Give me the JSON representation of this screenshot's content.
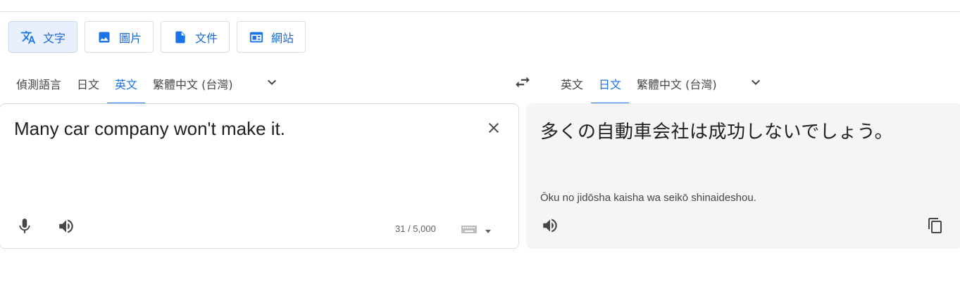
{
  "modes": [
    {
      "label": "文字",
      "icon": "translate-icon",
      "active": true
    },
    {
      "label": "圖片",
      "icon": "image-icon",
      "active": false
    },
    {
      "label": "文件",
      "icon": "document-icon",
      "active": false
    },
    {
      "label": "網站",
      "icon": "website-icon",
      "active": false
    }
  ],
  "source_langs": [
    {
      "label": "偵測語言",
      "active": false
    },
    {
      "label": "日文",
      "active": false
    },
    {
      "label": "英文",
      "active": true
    },
    {
      "label": "繁體中文 (台灣)",
      "active": false
    }
  ],
  "target_langs": [
    {
      "label": "英文",
      "active": false
    },
    {
      "label": "日文",
      "active": true
    },
    {
      "label": "繁體中文 (台灣)",
      "active": false
    }
  ],
  "source": {
    "text": "Many car company won't make it.",
    "char_count": "31 / 5,000"
  },
  "target": {
    "text": "多くの自動車会社は成功しないでしょう。",
    "romanization": "Ōku no jidōsha kaisha wa seikō shinaideshou."
  },
  "colors": {
    "accent": "#1a73e8",
    "active_mode_bg": "#e8f0fe",
    "target_panel_bg": "#f5f5f5",
    "icon_gray": "#444746"
  }
}
